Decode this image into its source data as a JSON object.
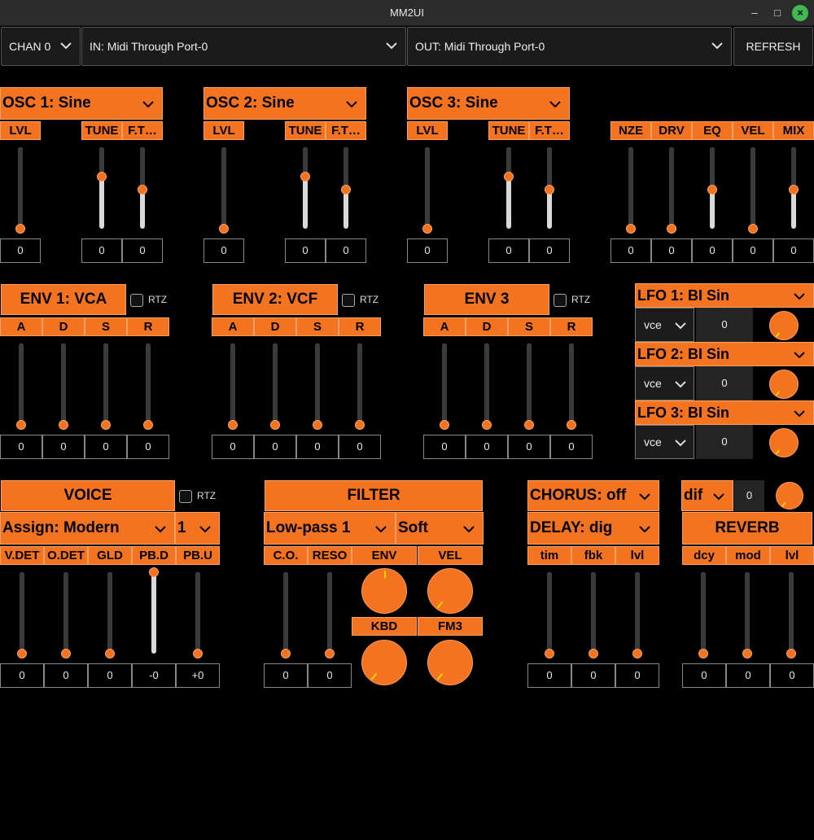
{
  "window": {
    "title": "MM2UI",
    "minimize": "–",
    "maximize": "□",
    "close": "×"
  },
  "top": {
    "chan": "CHAN 0",
    "in_port": "IN: Midi Through Port-0",
    "out_port": "OUT: Midi Through Port-0",
    "refresh": "REFRESH"
  },
  "osc": [
    {
      "title": "OSC 1: Sine",
      "lvl": "LVL",
      "tune": "TUNE",
      "ft": "F.T…",
      "values": [
        "0",
        "0",
        "0"
      ],
      "levels": [
        0,
        0.64,
        0.48
      ]
    },
    {
      "title": "OSC 2: Sine",
      "lvl": "LVL",
      "tune": "TUNE",
      "ft": "F.T…",
      "values": [
        "0",
        "0",
        "0"
      ],
      "levels": [
        0,
        0.64,
        0.48
      ]
    },
    {
      "title": "OSC 3: Sine",
      "lvl": "LVL",
      "tune": "TUNE",
      "ft": "F.T…",
      "values": [
        "0",
        "0",
        "0"
      ],
      "levels": [
        0,
        0.64,
        0.48
      ]
    }
  ],
  "mix": {
    "labels": [
      "NZE",
      "DRV",
      "EQ",
      "VEL",
      "MIX"
    ],
    "values": [
      "0",
      "0",
      "0",
      "0",
      "0"
    ],
    "levels": [
      0,
      0,
      0.48,
      0,
      0.48
    ]
  },
  "env": [
    {
      "title": "ENV 1: VCA",
      "rtz": "RTZ",
      "labels": [
        "A",
        "D",
        "S",
        "R"
      ],
      "values": [
        "0",
        "0",
        "0",
        "0"
      ]
    },
    {
      "title": "ENV 2: VCF",
      "rtz": "RTZ",
      "labels": [
        "A",
        "D",
        "S",
        "R"
      ],
      "values": [
        "0",
        "0",
        "0",
        "0"
      ]
    },
    {
      "title": "ENV 3",
      "rtz": "RTZ",
      "labels": [
        "A",
        "D",
        "S",
        "R"
      ],
      "values": [
        "0",
        "0",
        "0",
        "0"
      ]
    }
  ],
  "lfo": [
    {
      "title": "LFO 1: BI Sin",
      "mode": "vce",
      "value": "0"
    },
    {
      "title": "LFO 2: BI Sin",
      "mode": "vce",
      "value": "0"
    },
    {
      "title": "LFO 3: BI Sin",
      "mode": "vce",
      "value": "0"
    }
  ],
  "voice": {
    "title": "VOICE",
    "rtz": "RTZ",
    "assign": "Assign: Modern",
    "count": "1",
    "labels": [
      "V.DET",
      "O.DET",
      "GLD",
      "PB.D",
      "PB.U"
    ],
    "values": [
      "0",
      "0",
      "0",
      "-0",
      "+0"
    ],
    "levels": [
      0,
      0,
      0,
      1,
      0
    ]
  },
  "filter": {
    "title": "FILTER",
    "type": "Low-pass 1",
    "shape": "Soft",
    "labels": [
      "C.O.",
      "RESO"
    ],
    "values": [
      "0",
      "0"
    ],
    "levels": [
      0,
      0
    ],
    "knob_labels": [
      "ENV",
      "VEL",
      "KBD",
      "FM3"
    ]
  },
  "chorus": {
    "title": "CHORUS: off"
  },
  "delay": {
    "title": "DELAY: dig",
    "labels": [
      "tim",
      "fbk",
      "lvl"
    ],
    "values": [
      "0",
      "0",
      "0"
    ]
  },
  "reverb": {
    "type": "dif",
    "value": "0",
    "title": "REVERB",
    "labels": [
      "dcy",
      "mod",
      "lvl"
    ],
    "values": [
      "0",
      "0",
      "0"
    ]
  },
  "colors": {
    "accent": "#f47321",
    "accent_border": "#f8a060",
    "background": "#000000",
    "knob_pointer": "#ffd400"
  }
}
